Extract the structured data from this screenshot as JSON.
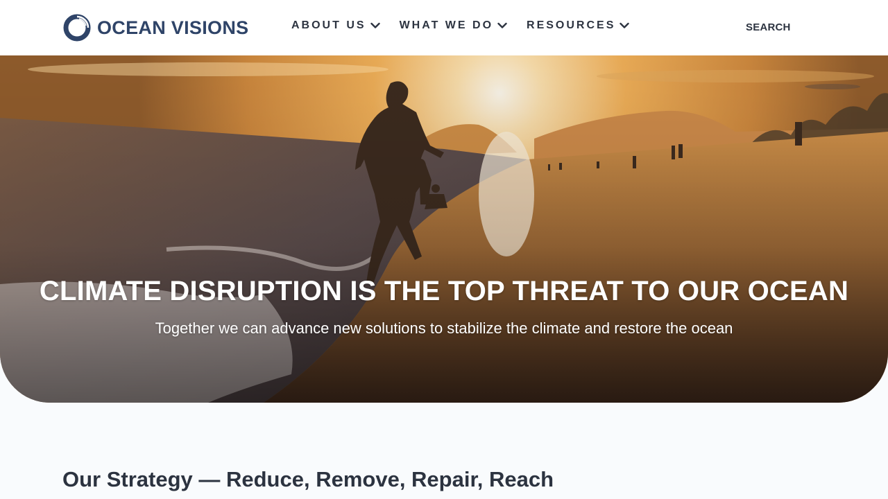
{
  "brand": {
    "logo_text": "OCEAN VISIONS",
    "logo_color": "#2f4468",
    "logo_icon": "ocean-visions-logo-icon"
  },
  "nav": {
    "items": [
      {
        "label": "ABOUT US",
        "icon": "chevron-down-icon"
      },
      {
        "label": "WHAT WE DO",
        "icon": "chevron-down-icon"
      },
      {
        "label": "RESOURCES",
        "icon": "chevron-down-icon"
      }
    ],
    "search_label": "SEARCH"
  },
  "hero": {
    "title": "CLIMATE DISRUPTION IS THE TOP THREAT TO OUR OCEAN",
    "subtitle": "Together we can advance new solutions to stabilize the climate and restore the ocean",
    "image_subject": "child running on beach at sunset"
  },
  "strategy": {
    "title": "Our Strategy — Reduce, Remove, Repair, Reach"
  },
  "colors": {
    "text_dark": "#2c3340",
    "page_bg": "#f9fbfd",
    "header_bg": "#ffffff"
  }
}
